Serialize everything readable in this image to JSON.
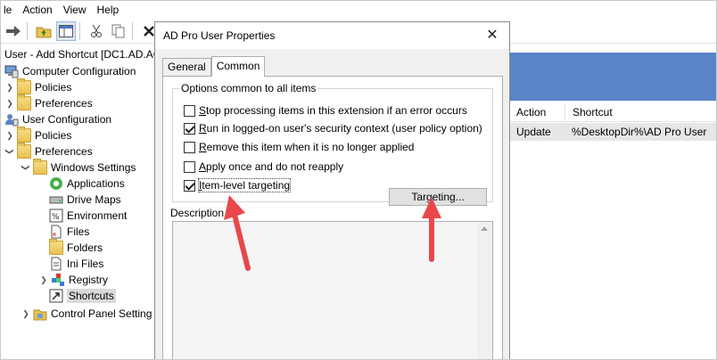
{
  "menubar": {
    "items": [
      "le",
      "Action",
      "View",
      "Help"
    ]
  },
  "toolbar": {
    "icons": [
      "forward-arrow-icon",
      "up-folder-icon",
      "show-hide-tree-icon",
      "cut-icon",
      "copy-icon",
      "delete-icon"
    ]
  },
  "tree": {
    "title": "User - Add Shortcut [DC1.AD.AC",
    "items": [
      {
        "label": "Computer Configuration"
      },
      {
        "label": "Policies"
      },
      {
        "label": "Preferences"
      },
      {
        "label": "User Configuration"
      },
      {
        "label": "Policies"
      },
      {
        "label": "Preferences"
      },
      {
        "label": "Windows Settings"
      },
      {
        "label": "Applications"
      },
      {
        "label": "Drive Maps"
      },
      {
        "label": "Environment"
      },
      {
        "label": "Files"
      },
      {
        "label": "Folders"
      },
      {
        "label": "Ini Files"
      },
      {
        "label": "Registry"
      },
      {
        "label": "Shortcuts"
      },
      {
        "label": "Control Panel Setting"
      }
    ]
  },
  "list": {
    "columns": [
      "Action",
      "Shortcut"
    ],
    "rows": [
      {
        "action": "Update",
        "shortcut": "%DesktopDir%\\AD Pro User"
      }
    ]
  },
  "dialog": {
    "title": "AD Pro User Properties",
    "close": "✕",
    "tabs": [
      "General",
      "Common"
    ],
    "active_tab": "Common",
    "group_label": "Options common to all items",
    "options": [
      {
        "label": "Stop processing items in this extension if an error occurs",
        "checked": false
      },
      {
        "label": "Run in logged-on user's security context (user policy option)",
        "checked": true
      },
      {
        "label": "Remove this item when it is no longer applied",
        "checked": false
      },
      {
        "label": "Apply once and do not reapply",
        "checked": false
      },
      {
        "label": "Item-level targeting",
        "checked": true
      }
    ],
    "targeting_button": "Targeting...",
    "description_label": "Description"
  },
  "colors": {
    "banner": "#5c84c8",
    "annotation_arrow": "#e8474c",
    "selection": "#d9d9d9"
  }
}
